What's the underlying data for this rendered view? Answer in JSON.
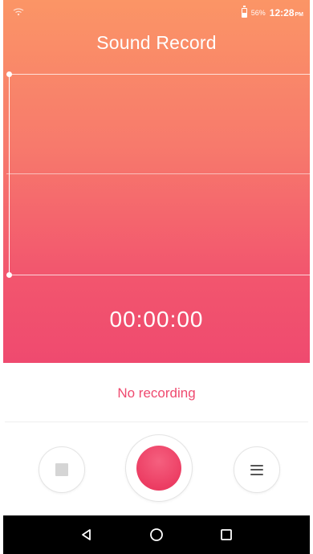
{
  "status_bar": {
    "battery_percent": "56%",
    "time": "12:28",
    "ampm": "PM"
  },
  "header": {
    "title": "Sound Record"
  },
  "recorder": {
    "timer": "00:00:00",
    "status_text": "No recording"
  },
  "controls": {
    "stop_icon": "stop-icon",
    "record_icon": "record-icon",
    "list_icon": "list-icon"
  },
  "navigation": {
    "back_icon": "back-triangle-icon",
    "home_icon": "home-circle-icon",
    "recents_icon": "recents-square-icon"
  },
  "colors": {
    "gradient_top": "#fb9566",
    "gradient_bottom": "#ef4a6f",
    "accent": "#ef4a6f",
    "nav_bar": "#000000"
  }
}
